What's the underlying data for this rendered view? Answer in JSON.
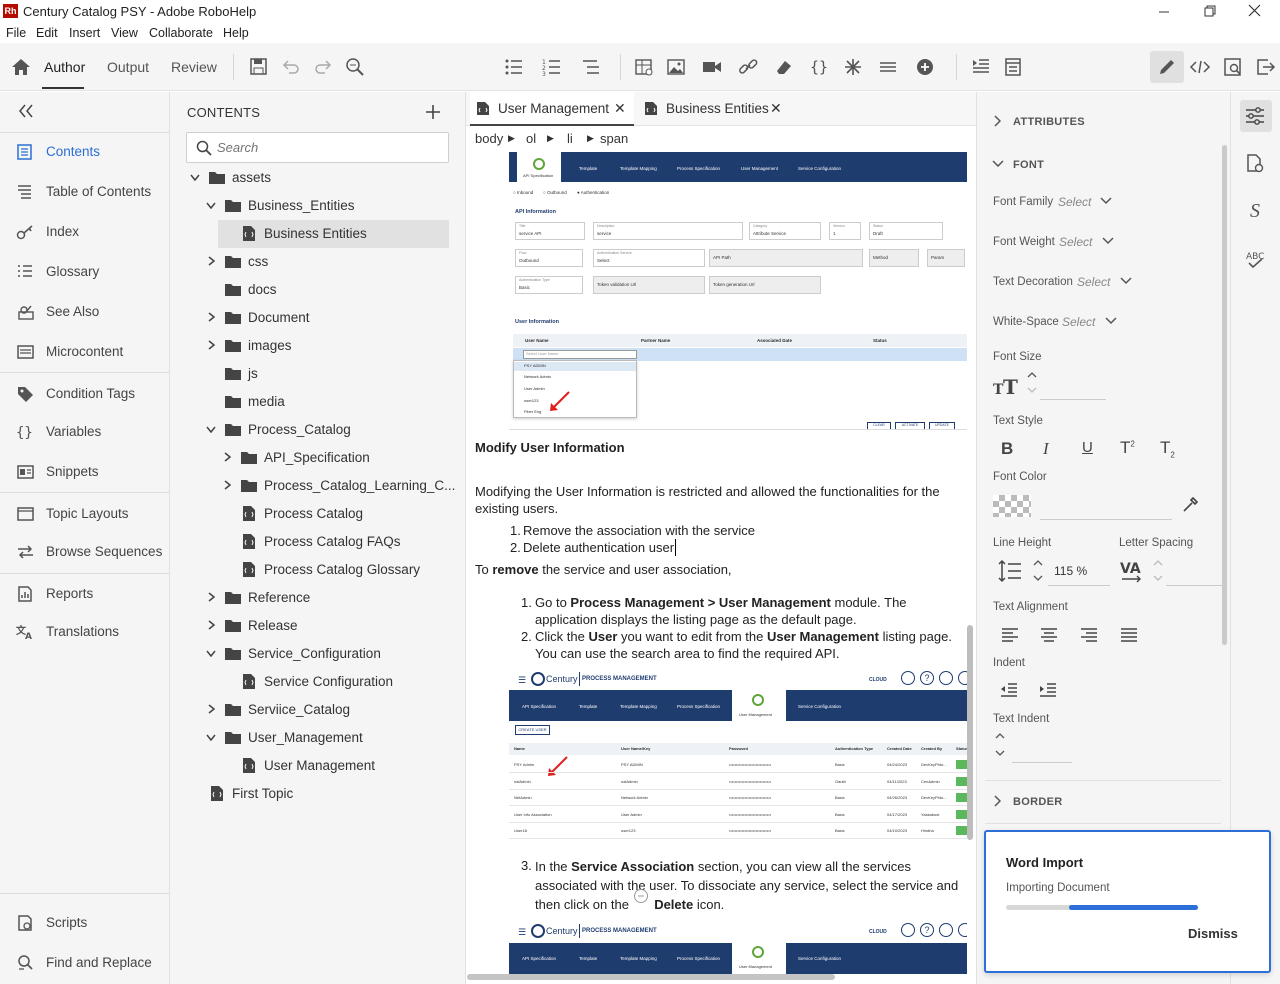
{
  "window": {
    "app_logo": "Rh",
    "title": "Century Catalog PSY - Adobe RoboHelp"
  },
  "menu": [
    "File",
    "Edit",
    "Insert",
    "View",
    "Collaborate",
    "Help"
  ],
  "toolbar": {
    "tabs": [
      "Author",
      "Output",
      "Review"
    ],
    "active_tab": "Author"
  },
  "leftnav": {
    "items": [
      {
        "label": "Contents",
        "icon": "contents-icon",
        "active": true
      },
      {
        "label": "Table of Contents",
        "icon": "toc-icon"
      },
      {
        "label": "Index",
        "icon": "index-key-icon"
      },
      {
        "label": "Glossary",
        "icon": "glossary-list-icon"
      },
      {
        "label": "See Also",
        "icon": "see-also-icon"
      },
      {
        "label": "Microcontent",
        "icon": "microcontent-icon"
      },
      {
        "label": "Condition Tags",
        "icon": "tag-icon"
      },
      {
        "label": "Variables",
        "icon": "braces-icon"
      },
      {
        "label": "Snippets",
        "icon": "snippets-icon"
      },
      {
        "label": "Topic Layouts",
        "icon": "layout-icon"
      },
      {
        "label": "Browse Sequences",
        "icon": "arrows-icon"
      },
      {
        "label": "Reports",
        "icon": "reports-icon"
      },
      {
        "label": "Translations",
        "icon": "translate-icon"
      },
      {
        "label": "Scripts",
        "icon": "scripts-icon"
      },
      {
        "label": "Find and Replace",
        "icon": "find-replace-icon"
      }
    ]
  },
  "contents": {
    "title": "CONTENTS",
    "search_placeholder": "Search",
    "tree": [
      {
        "label": "assets",
        "type": "folder",
        "level": 0,
        "state": "open"
      },
      {
        "label": "Business_Entities",
        "type": "folder",
        "level": 1,
        "state": "open"
      },
      {
        "label": "Business Entities",
        "type": "topic",
        "level": 2,
        "selected": true
      },
      {
        "label": "css",
        "type": "folder",
        "level": 1,
        "state": "closed"
      },
      {
        "label": "docs",
        "type": "folder",
        "level": 1,
        "state": "none"
      },
      {
        "label": "Document",
        "type": "folder",
        "level": 1,
        "state": "closed"
      },
      {
        "label": "images",
        "type": "folder",
        "level": 1,
        "state": "closed"
      },
      {
        "label": "js",
        "type": "folder",
        "level": 1,
        "state": "none"
      },
      {
        "label": "media",
        "type": "folder",
        "level": 1,
        "state": "none"
      },
      {
        "label": "Process_Catalog",
        "type": "folder",
        "level": 1,
        "state": "open"
      },
      {
        "label": "API_Specification",
        "type": "folder",
        "level": 2,
        "state": "closed"
      },
      {
        "label": "Process_Catalog_Learning_C...",
        "type": "folder",
        "level": 2,
        "state": "closed"
      },
      {
        "label": "Process Catalog",
        "type": "topic",
        "level": 2
      },
      {
        "label": "Process Catalog FAQs",
        "type": "topic",
        "level": 2
      },
      {
        "label": "Process Catalog Glossary",
        "type": "topic",
        "level": 2
      },
      {
        "label": "Reference",
        "type": "folder",
        "level": 1,
        "state": "closed"
      },
      {
        "label": "Release",
        "type": "folder",
        "level": 1,
        "state": "closed"
      },
      {
        "label": "Service_Configuration",
        "type": "folder",
        "level": 1,
        "state": "open"
      },
      {
        "label": "Service Configuration",
        "type": "topic",
        "level": 2
      },
      {
        "label": "Serviice_Catalog",
        "type": "folder",
        "level": 1,
        "state": "closed"
      },
      {
        "label": "User_Management",
        "type": "folder",
        "level": 1,
        "state": "open"
      },
      {
        "label": "User Management",
        "type": "topic",
        "level": 2
      },
      {
        "label": "First Topic",
        "type": "topic",
        "level": 0
      }
    ]
  },
  "editor": {
    "tabs": [
      {
        "label": "User Management",
        "active": true
      },
      {
        "label": "Business Entities",
        "active": false
      }
    ],
    "breadcrumb": [
      "body",
      "ol",
      "li",
      "span"
    ],
    "content": {
      "heading": "Modify User Information",
      "para1": "Modifying the User Information is restricted and allowed the functionalities for the existing users.",
      "list1": [
        "Remove the association with the service",
        "Delete authentication user"
      ],
      "para2_pre": "To ",
      "para2_bold": "remove",
      "para2_post": " the service and user association,",
      "step1": {
        "n": "1.",
        "a": "Go to ",
        "b": "Process Management > User Management",
        "c": " module. The application displays the listing page as the default page."
      },
      "step2": {
        "n": "2.",
        "a": "Click the ",
        "b": "User",
        "c": " you want to edit from the ",
        "d": "User Management",
        "e": " listing page. You can use the search area to find the required API."
      },
      "step3": {
        "n": "3.",
        "a": "In the ",
        "b": "Service Association",
        "c": " section, you can view all the services associated with the user. To dissociate any service, select the service and then click on the ",
        "d": "Delete",
        "e": " icon."
      }
    },
    "screenshot1": {
      "tabs": [
        "API Specification",
        "Template",
        "Template Mapping",
        "Process Specification",
        "User Management",
        "Service Configuration"
      ],
      "radios": [
        "Inbound",
        "Outbound",
        "Authentication"
      ],
      "section_api": "API Information",
      "fields_row1": [
        {
          "label": "Title",
          "value": "service API"
        },
        {
          "label": "Description",
          "value": "service"
        },
        {
          "label": "Category",
          "value": "Attribute Service"
        },
        {
          "label": "Version",
          "value": "1"
        },
        {
          "label": "Status",
          "value": "Draft"
        }
      ],
      "fields_row2": [
        {
          "label": "Flow",
          "value": "Outbound"
        },
        {
          "label": "Authentication Service",
          "value": "Select"
        },
        {
          "label": "",
          "value": "API Path"
        },
        {
          "label": "",
          "value": "Method"
        },
        {
          "label": "",
          "value": "Param"
        }
      ],
      "fields_row3": [
        {
          "label": "Authentication Type",
          "value": "Basic"
        },
        {
          "label": "",
          "value": "Token validation Url"
        },
        {
          "label": "",
          "value": "Token generation Url"
        }
      ],
      "section_user": "User Information",
      "table_headers": [
        "User Name",
        "Partner Name",
        "Associated Date",
        "Status"
      ],
      "dropdown_placeholder": "Select User Name",
      "dropdown_options": [
        "PSY ADMIN",
        "Network Admin",
        "User Admin",
        "user123",
        "Fiber Eng"
      ],
      "buttons": [
        "CLEAR",
        "ACTIVATE",
        "UPDATE"
      ]
    },
    "screenshot2": {
      "brand": "Century",
      "module": "PROCESS MANAGEMENT",
      "cloud": "CLOUD",
      "tabs": [
        "API Specification",
        "Template",
        "Template Mapping",
        "Process Specification",
        "User Management",
        "Service Configuration"
      ],
      "create_btn": "CREATE USER",
      "headers": [
        "Name",
        "User Name/Key",
        "Password",
        "Authentication Type",
        "Created Date",
        "Created By",
        "Status"
      ],
      "rows": [
        [
          "PSY Admin",
          "PSY ADMIN",
          "••••••••••••••••••••••••••••••",
          "Basic",
          "04/24/2023",
          "DevKeyPhto...",
          ""
        ],
        [
          "nalAdmin",
          "nalAdmin",
          "••••••••••••••••••••••••••••••",
          "Oauth",
          "04/11/2023",
          "CenAdmin",
          ""
        ],
        [
          "NetAdmin",
          "Network Admin",
          "••••••••••••••••••••••••••••••",
          "Basic",
          "04/26/2023",
          "DevKeyPhto...",
          ""
        ],
        [
          "User Info Association",
          "User Admin",
          "••••••••••••••••••••••••••••••",
          "Basic",
          "04/17/2023",
          "Yaskabust",
          ""
        ],
        [
          "User18",
          "user123",
          "••••••••••••••••••••••••••••••",
          "Basic",
          "04/10/2023",
          "Hindha",
          ""
        ]
      ]
    },
    "screenshot3": {
      "brand": "Century",
      "module": "PROCESS MANAGEMENT",
      "cloud": "CLOUD",
      "tabs": [
        "API Specification",
        "Template",
        "Template Mapping",
        "Process Specification",
        "User Management",
        "Service Configuration"
      ]
    }
  },
  "properties": {
    "attributes_label": "ATTRIBUTES",
    "font_label": "FONT",
    "font_family": {
      "label": "Font Family",
      "value": "Select"
    },
    "font_weight": {
      "label": "Font Weight",
      "value": "Select"
    },
    "text_decoration": {
      "label": "Text Decoration",
      "value": "Select"
    },
    "white_space": {
      "label": "White-Space",
      "value": "Select"
    },
    "font_size_label": "Font Size",
    "text_style_label": "Text Style",
    "font_color_label": "Font Color",
    "line_height_label": "Line Height",
    "line_height_value": "115 %",
    "letter_spacing_label": "Letter Spacing",
    "text_alignment_label": "Text Alignment",
    "indent_label": "Indent",
    "text_indent_label": "Text Indent",
    "border_label": "BORDER"
  },
  "word_import": {
    "title": "Word Import",
    "status": "Importing Document",
    "progress": 0.67,
    "dismiss": "Dismiss"
  },
  "colors": {
    "accent": "#2b6ed5",
    "navy": "#1f3c6e",
    "logo": "#b30b00"
  }
}
